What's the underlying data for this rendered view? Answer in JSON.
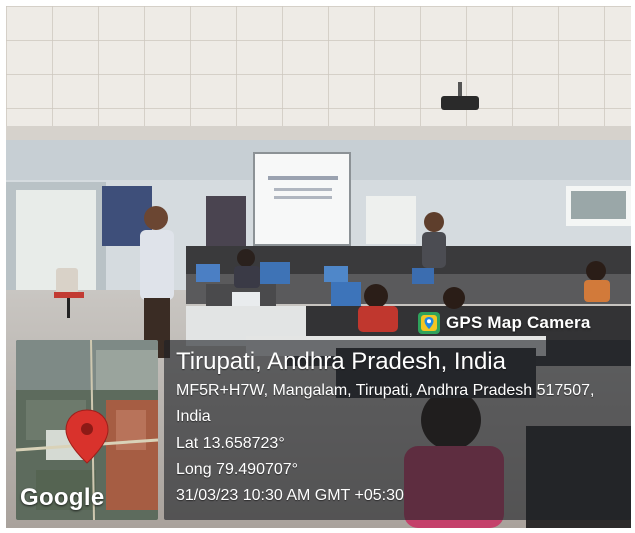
{
  "overlay": {
    "app_name": "GPS Map Camera",
    "map_brand": "Google",
    "location_title": "Tirupati, Andhra Pradesh, India",
    "address_line1": "MF5R+H7W, Mangalam, Tirupati, Andhra Pradesh 517507,",
    "address_line2": "India",
    "latitude": "Lat 13.658723°",
    "longitude": "Long 79.490707°",
    "datetime": "31/03/23 10:30 AM GMT +05:30"
  },
  "colors": {
    "pin": "#d9322c",
    "info_panel": "#1e2226",
    "ceiling": "#ece8e2",
    "wall": "#d8dde0"
  }
}
